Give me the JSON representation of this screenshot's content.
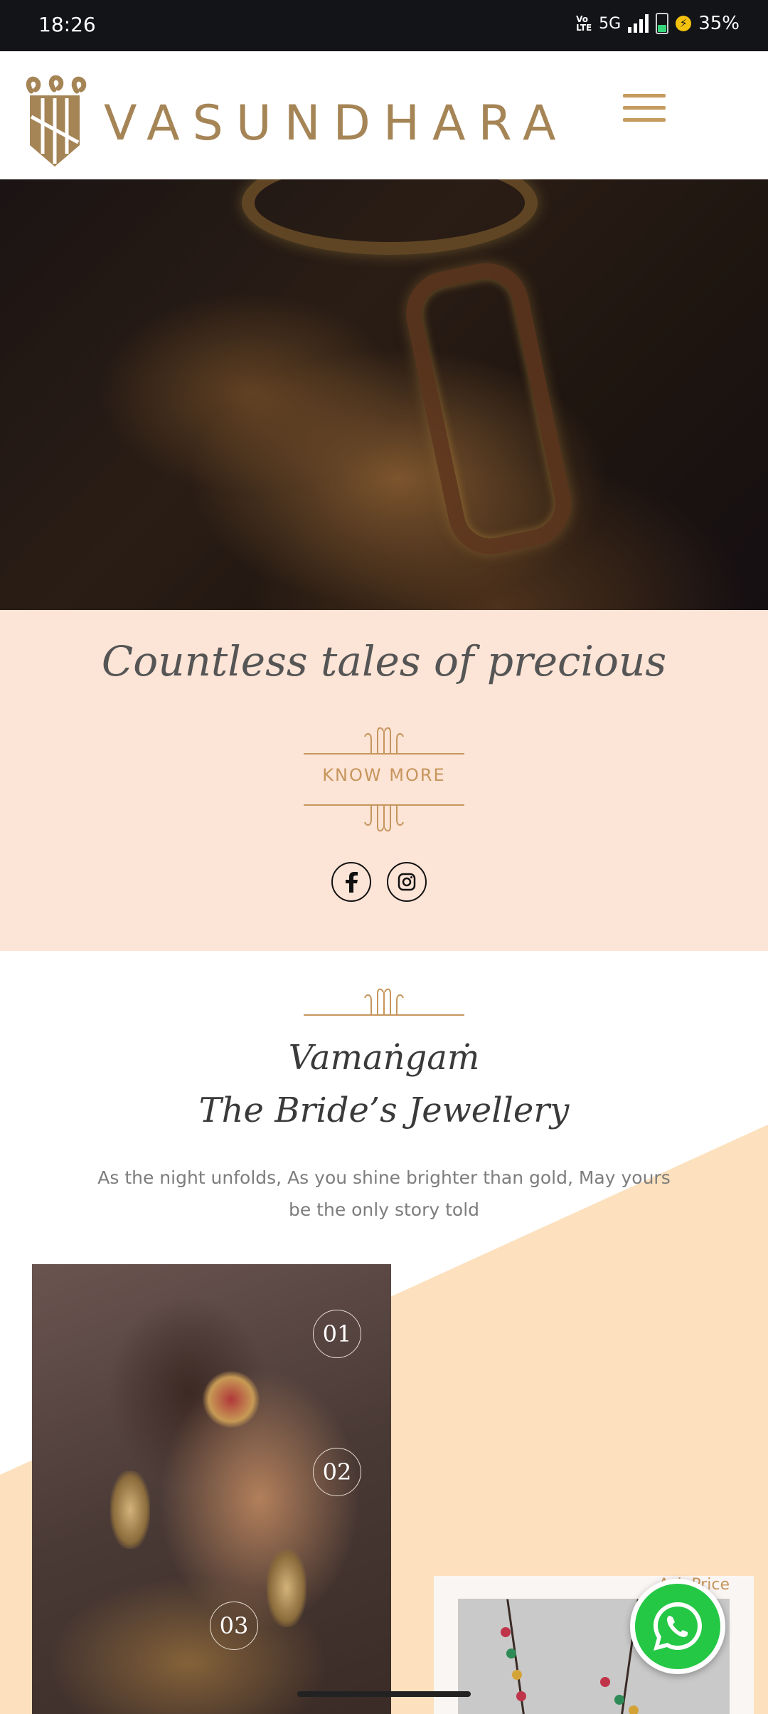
{
  "status_bar": {
    "time": "18:26",
    "network_small": "Vo LTE",
    "network": "5G",
    "battery": "35%"
  },
  "header": {
    "brand": "VASUNDHARA",
    "menu_icon": "hamburger-menu-icon",
    "brand_color": "#a58456"
  },
  "hero": {
    "tagline": "Countless tales of precious",
    "cta_label": "KNOW MORE",
    "social": [
      "facebook-icon",
      "instagram-icon"
    ],
    "background": "#fce4d6"
  },
  "collection": {
    "title_line1": "Vamaṅgaṁ",
    "title_line2": "The Bride’s Jewellery",
    "description": "As the night unfolds, As you shine brighter than gold, May yours be the only story told",
    "hotspots": [
      "01",
      "02",
      "03"
    ],
    "accent": "#fde0bd",
    "price_link": "Ask Price"
  },
  "floating": {
    "whatsapp": "whatsapp-icon",
    "color": "#24c845"
  }
}
